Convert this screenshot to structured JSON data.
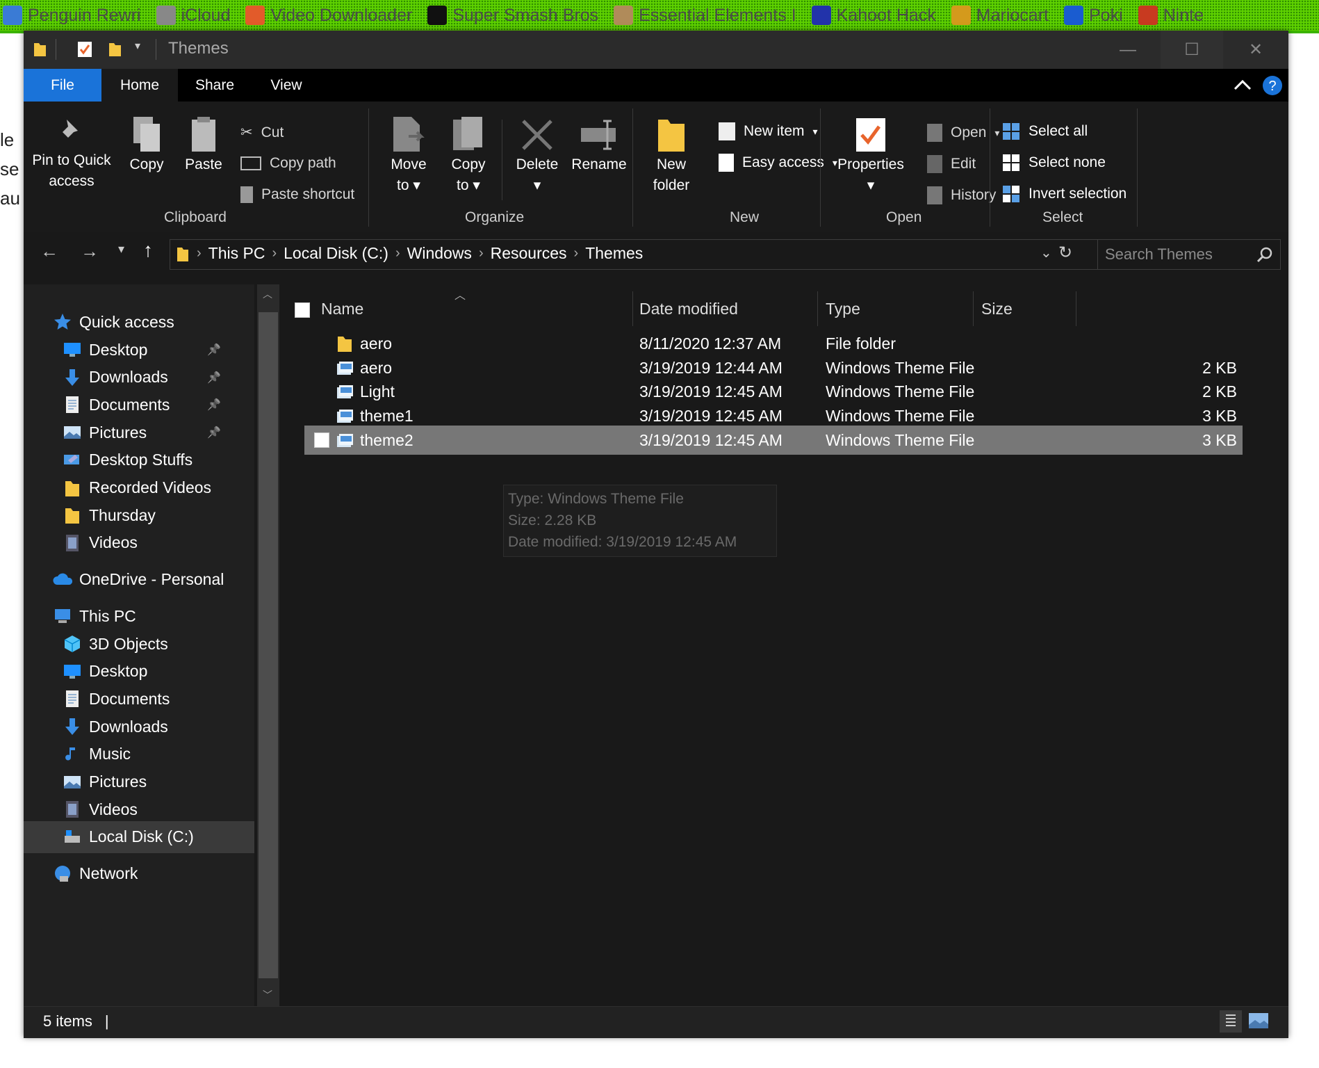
{
  "bookmarks": [
    {
      "label": "Penguin Rewri",
      "color": "#3a7bd5"
    },
    {
      "label": "iCloud",
      "color": "#888888"
    },
    {
      "label": "Video Downloader",
      "color": "#e25b2a"
    },
    {
      "label": "Super Smash Bros",
      "color": "#111111"
    },
    {
      "label": "Essential Elements I",
      "color": "#b08b5a"
    },
    {
      "label": "Kahoot Hack",
      "color": "#2233aa"
    },
    {
      "label": "Mariocart",
      "color": "#d49a1c"
    },
    {
      "label": "Poki",
      "color": "#1a5cd0"
    },
    {
      "label": "Ninte",
      "color": "#c83a20"
    }
  ],
  "behind_text": [
    "le",
    "se",
    "au"
  ],
  "window": {
    "title": "Themes",
    "controls": {
      "minimize": "—",
      "maximize": "☐",
      "close": "✕"
    }
  },
  "tabs": {
    "file": "File",
    "home": "Home",
    "share": "Share",
    "view": "View"
  },
  "ribbon": {
    "clipboard": {
      "pin_line1": "Pin to Quick",
      "pin_line2": "access",
      "copy": "Copy",
      "paste": "Paste",
      "cut": "Cut",
      "copy_path": "Copy path",
      "paste_shortcut": "Paste shortcut",
      "label": "Clipboard"
    },
    "organize": {
      "move_line1": "Move",
      "move_line2": "to",
      "copy_line1": "Copy",
      "copy_line2": "to",
      "delete": "Delete",
      "rename": "Rename",
      "label": "Organize"
    },
    "new": {
      "folder_line1": "New",
      "folder_line2": "folder",
      "new_item": "New item",
      "easy_access": "Easy access",
      "label": "New"
    },
    "open": {
      "properties": "Properties",
      "open": "Open",
      "edit": "Edit",
      "history": "History",
      "label": "Open"
    },
    "select": {
      "select_all": "Select all",
      "select_none": "Select none",
      "invert": "Invert selection",
      "label": "Select"
    }
  },
  "address": {
    "crumbs": [
      "This PC",
      "Local Disk (C:)",
      "Windows",
      "Resources",
      "Themes"
    ],
    "search_placeholder": "Search Themes"
  },
  "nav": {
    "quick_access": "Quick access",
    "quick_items": [
      {
        "label": "Desktop",
        "icon": "desktop-icon",
        "pinned": true
      },
      {
        "label": "Downloads",
        "icon": "downloads-icon",
        "pinned": true
      },
      {
        "label": "Documents",
        "icon": "documents-icon",
        "pinned": true
      },
      {
        "label": "Pictures",
        "icon": "pictures-icon",
        "pinned": true
      },
      {
        "label": "Desktop Stuffs",
        "icon": "desktop-folder-icon",
        "pinned": false
      },
      {
        "label": "Recorded Videos",
        "icon": "folder-icon",
        "pinned": false
      },
      {
        "label": "Thursday",
        "icon": "folder-icon",
        "pinned": false
      },
      {
        "label": "Videos",
        "icon": "videos-icon",
        "pinned": false
      }
    ],
    "onedrive": "OneDrive - Personal",
    "this_pc": "This PC",
    "pc_items": [
      {
        "label": "3D Objects",
        "icon": "3d-objects-icon"
      },
      {
        "label": "Desktop",
        "icon": "desktop-icon"
      },
      {
        "label": "Documents",
        "icon": "documents-icon"
      },
      {
        "label": "Downloads",
        "icon": "downloads-icon"
      },
      {
        "label": "Music",
        "icon": "music-icon"
      },
      {
        "label": "Pictures",
        "icon": "pictures-icon"
      },
      {
        "label": "Videos",
        "icon": "videos-icon"
      },
      {
        "label": "Local Disk (C:)",
        "icon": "local-disk-icon"
      }
    ],
    "network": "Network"
  },
  "columns": {
    "name": "Name",
    "date": "Date modified",
    "type": "Type",
    "size": "Size"
  },
  "files": [
    {
      "name": "aero",
      "date": "8/11/2020 12:37 AM",
      "type": "File folder",
      "size": "",
      "icon": "folder-icon"
    },
    {
      "name": "aero",
      "date": "3/19/2019 12:44 AM",
      "type": "Windows Theme File",
      "size": "2 KB",
      "icon": "theme-file-icon"
    },
    {
      "name": "Light",
      "date": "3/19/2019 12:45 AM",
      "type": "Windows Theme File",
      "size": "2 KB",
      "icon": "theme-file-icon"
    },
    {
      "name": "theme1",
      "date": "3/19/2019 12:45 AM",
      "type": "Windows Theme File",
      "size": "3 KB",
      "icon": "theme-file-icon"
    },
    {
      "name": "theme2",
      "date": "3/19/2019 12:45 AM",
      "type": "Windows Theme File",
      "size": "3 KB",
      "icon": "theme-file-icon"
    }
  ],
  "tooltip": {
    "type": "Type: Windows Theme File",
    "size": "Size: 2.28 KB",
    "date": "Date modified: 3/19/2019 12:45 AM"
  },
  "status": {
    "items": "5 items"
  }
}
